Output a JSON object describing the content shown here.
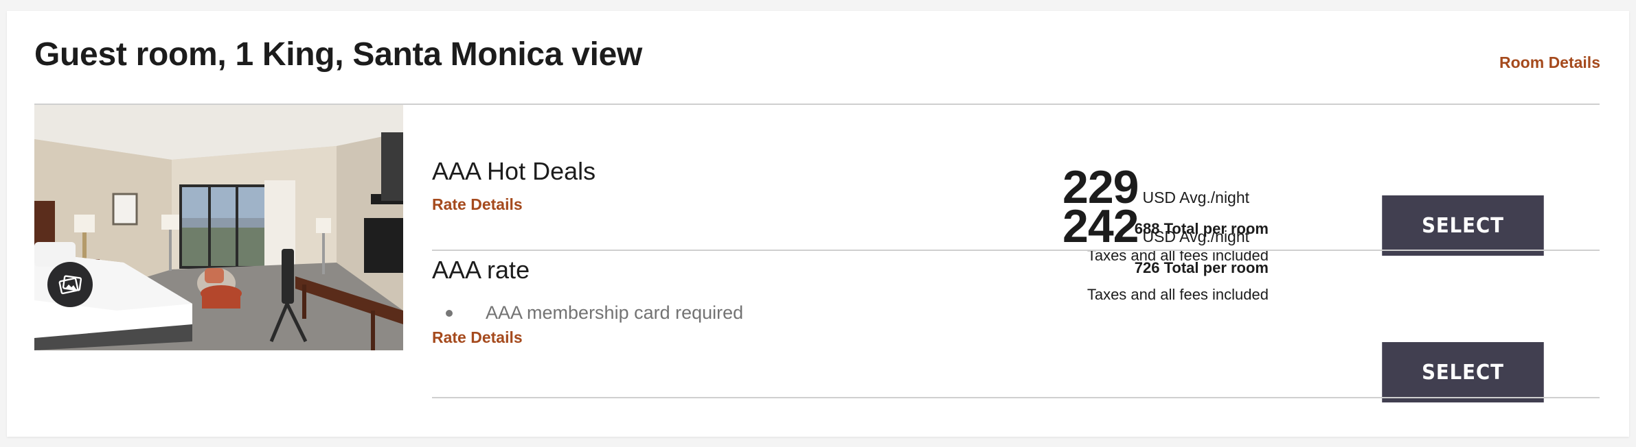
{
  "room": {
    "title": "Guest room, 1 King, Santa Monica view",
    "details_link": "Room Details",
    "photo_icon": "image-gallery-icon"
  },
  "rates": [
    {
      "name": "AAA Hot Deals",
      "details_link": "Rate Details",
      "price": "229",
      "price_unit": "USD Avg./night",
      "total_amount": "688",
      "total_label": "Total per room",
      "taxes": "Taxes and all fees included",
      "select_label": "SELECT"
    },
    {
      "name": "AAA rate",
      "requirement": "AAA membership card required",
      "details_link": "Rate Details",
      "price": "242",
      "price_unit": "USD Avg./night",
      "total_amount": "726",
      "total_label": "Total per room",
      "taxes": "Taxes and all fees included",
      "select_label": "SELECT"
    }
  ],
  "colors": {
    "accent_link": "#a54a1d",
    "button_bg": "#413f50",
    "divider": "#cfcfcf"
  }
}
